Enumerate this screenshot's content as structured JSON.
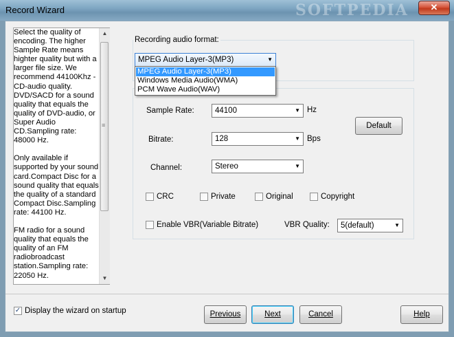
{
  "window": {
    "title": "Record Wizard",
    "watermark": "SOFTPEDIA",
    "close_glyph": "✕"
  },
  "help": {
    "text": "Select the quality of encoding. The higher Sample Rate means highter quality but with a larger file size. We recommend 44100Khz - CD-audio quality.\nDVD/SACD for a sound quality that equals the quality of DVD-audio, or Super Audio CD.Sampling rate: 48000 Hz.\n\nOnly available if supported by your sound card.Compact Disc for a sound quality that equals the quality of a standard Compact Disc.Sampling rate: 44100 Hz.\n\nFM radio for a sound quality that equals the quality of an FM radiobroadcast station.Sampling rate: 22050 Hz."
  },
  "format": {
    "label": "Recording audio format:",
    "selected": "MPEG Audio Layer-3(MP3)",
    "options": [
      "MPEG Audio Layer-3(MP3)",
      "Windows Media Audio(WMA)",
      "PCM Wave Audio(WAV)"
    ],
    "dropdown_open": true
  },
  "settings": {
    "sample_rate": {
      "label": "Sample Rate:",
      "value": "44100",
      "unit": "Hz"
    },
    "bitrate": {
      "label": "Bitrate:",
      "value": "128",
      "unit": "Bps"
    },
    "channel": {
      "label": "Channel:",
      "value": "Stereo"
    },
    "default_button": "Default",
    "checkboxes": {
      "crc": {
        "label": "CRC",
        "checked": false
      },
      "private": {
        "label": "Private",
        "checked": false
      },
      "original": {
        "label": "Original",
        "checked": false
      },
      "copyright": {
        "label": "Copyright",
        "checked": false
      },
      "vbr": {
        "label": "Enable VBR(Variable Bitrate)",
        "checked": false
      }
    },
    "vbr_quality": {
      "label": "VBR Quality:",
      "value": "5(default)"
    }
  },
  "footer": {
    "startup_label": "Display the wizard on startup",
    "startup_checked": true,
    "check_glyph": "✓",
    "previous": "Previous",
    "next": "Next",
    "cancel": "Cancel",
    "help": "Help"
  },
  "icons": {
    "dropdown": "chevron-down-icon",
    "scroll_up": "arrow-up-icon",
    "scroll_down": "arrow-down-icon",
    "close": "close-icon"
  }
}
